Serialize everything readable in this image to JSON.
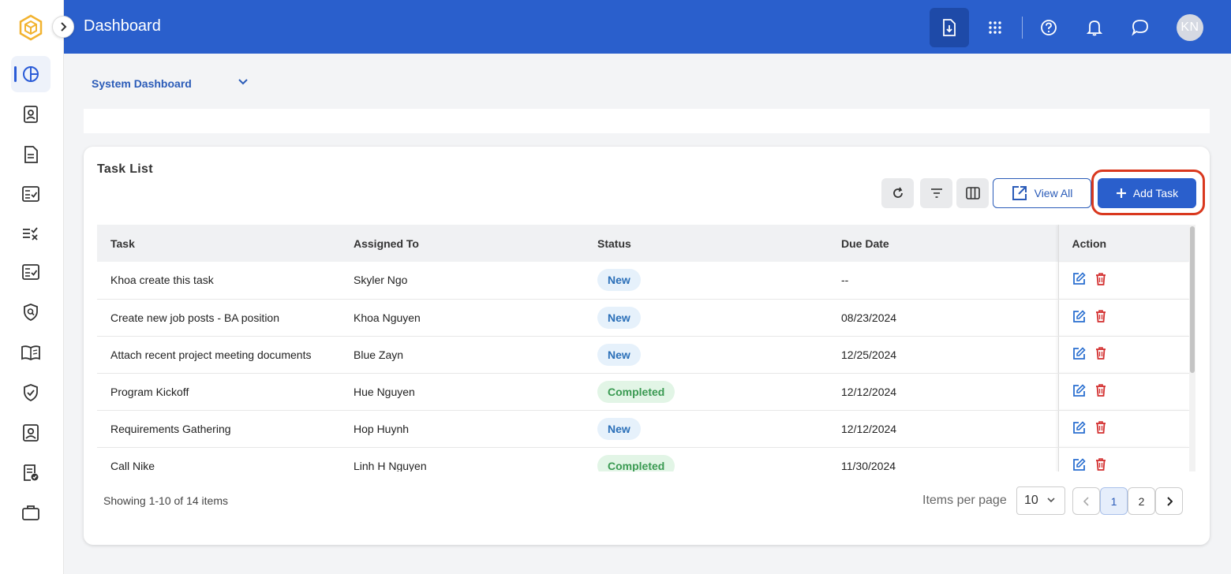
{
  "header": {
    "title": "Dashboard",
    "avatar_initials": "KN",
    "icons": [
      "export-icon",
      "apps-grid-icon",
      "help-icon",
      "bell-icon",
      "chat-icon"
    ]
  },
  "dashboard_select": {
    "value": "System Dashboard"
  },
  "task_list": {
    "title": "Task List",
    "view_all_label": "View All",
    "add_task_label": "Add Task",
    "columns": [
      "Task",
      "Assigned To",
      "Status",
      "Due Date",
      "Action"
    ],
    "rows": [
      {
        "task": "Khoa create this task",
        "assigned": "Skyler Ngo",
        "status": "New",
        "due": "--"
      },
      {
        "task": "Create new job posts - BA position",
        "assigned": "Khoa Nguyen",
        "status": "New",
        "due": "08/23/2024"
      },
      {
        "task": "Attach recent project meeting documents",
        "assigned": "Blue Zayn",
        "status": "New",
        "due": "12/25/2024"
      },
      {
        "task": "Program Kickoff",
        "assigned": "Hue Nguyen",
        "status": "Completed",
        "due": "12/12/2024"
      },
      {
        "task": "Requirements Gathering",
        "assigned": "Hop Huynh",
        "status": "New",
        "due": "12/12/2024"
      },
      {
        "task": "Call Nike",
        "assigned": "Linh H Nguyen",
        "status": "Completed",
        "due": "11/30/2024"
      }
    ]
  },
  "pagination": {
    "showing_text": "Showing 1-10 of 14 items",
    "items_per_page_label": "Items per page",
    "items_per_page_value": "10",
    "pages": [
      "1",
      "2"
    ],
    "current_page": "1"
  },
  "colors": {
    "header_bg": "#2a5fcc",
    "primary": "#2a5fcc",
    "highlight_ring": "#d9381e",
    "badge_new": "#2a6fb8",
    "badge_completed": "#3a9a52",
    "delete": "#d32f2f"
  }
}
